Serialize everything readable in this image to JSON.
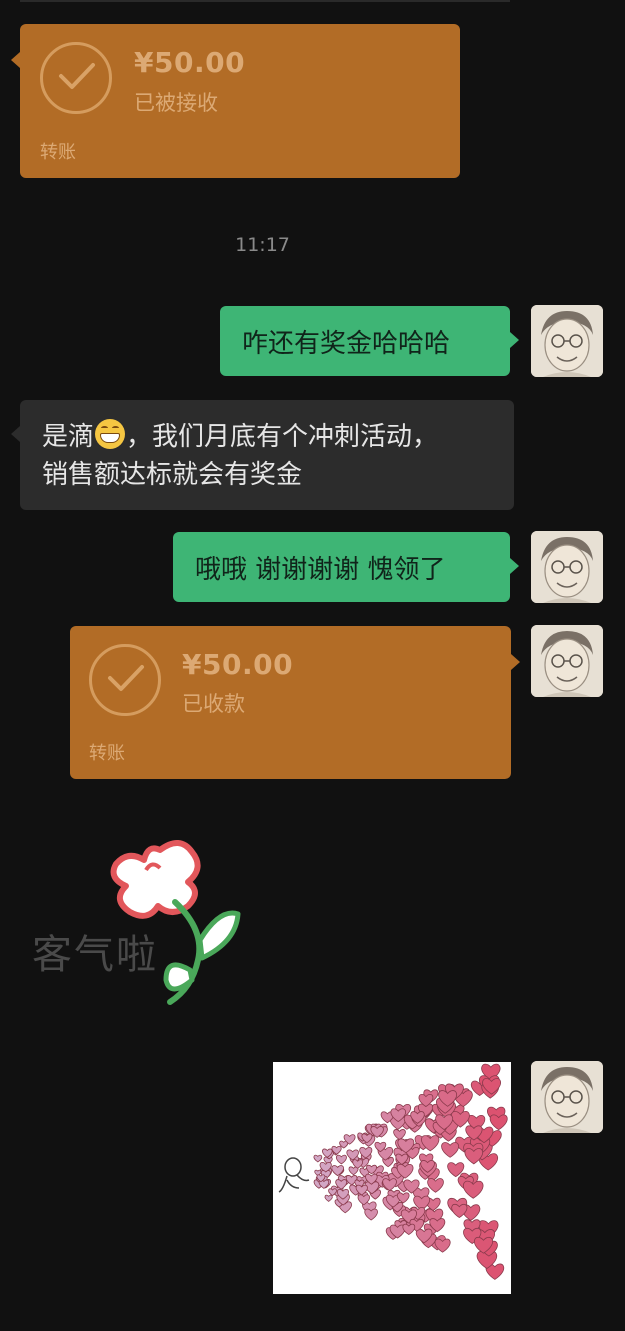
{
  "messages": {
    "transfer1": {
      "amount": "¥50.00",
      "status": "已被接收",
      "label": "转账"
    },
    "time": "11:17",
    "sent1": "咋还有奖金哈哈哈",
    "received1_part1": "是滴",
    "received1_part2": "，我们月底有个冲刺活动，",
    "received1_line2": "销售额达标就会有奖金",
    "sent2": "哦哦 谢谢谢谢 愧领了",
    "transfer2": {
      "amount": "¥50.00",
      "status": "已收款",
      "label": "转账"
    },
    "sticker_text": "客气啦"
  },
  "colors": {
    "background": "#111111",
    "transfer": "#b26c26",
    "sent_bubble": "#3eb575",
    "received_bubble": "#2c2c2c"
  },
  "icons": [
    "check-circle-icon",
    "grinning-emoji-icon",
    "flower-sticker",
    "hearts-sticker",
    "avatar-portrait"
  ]
}
